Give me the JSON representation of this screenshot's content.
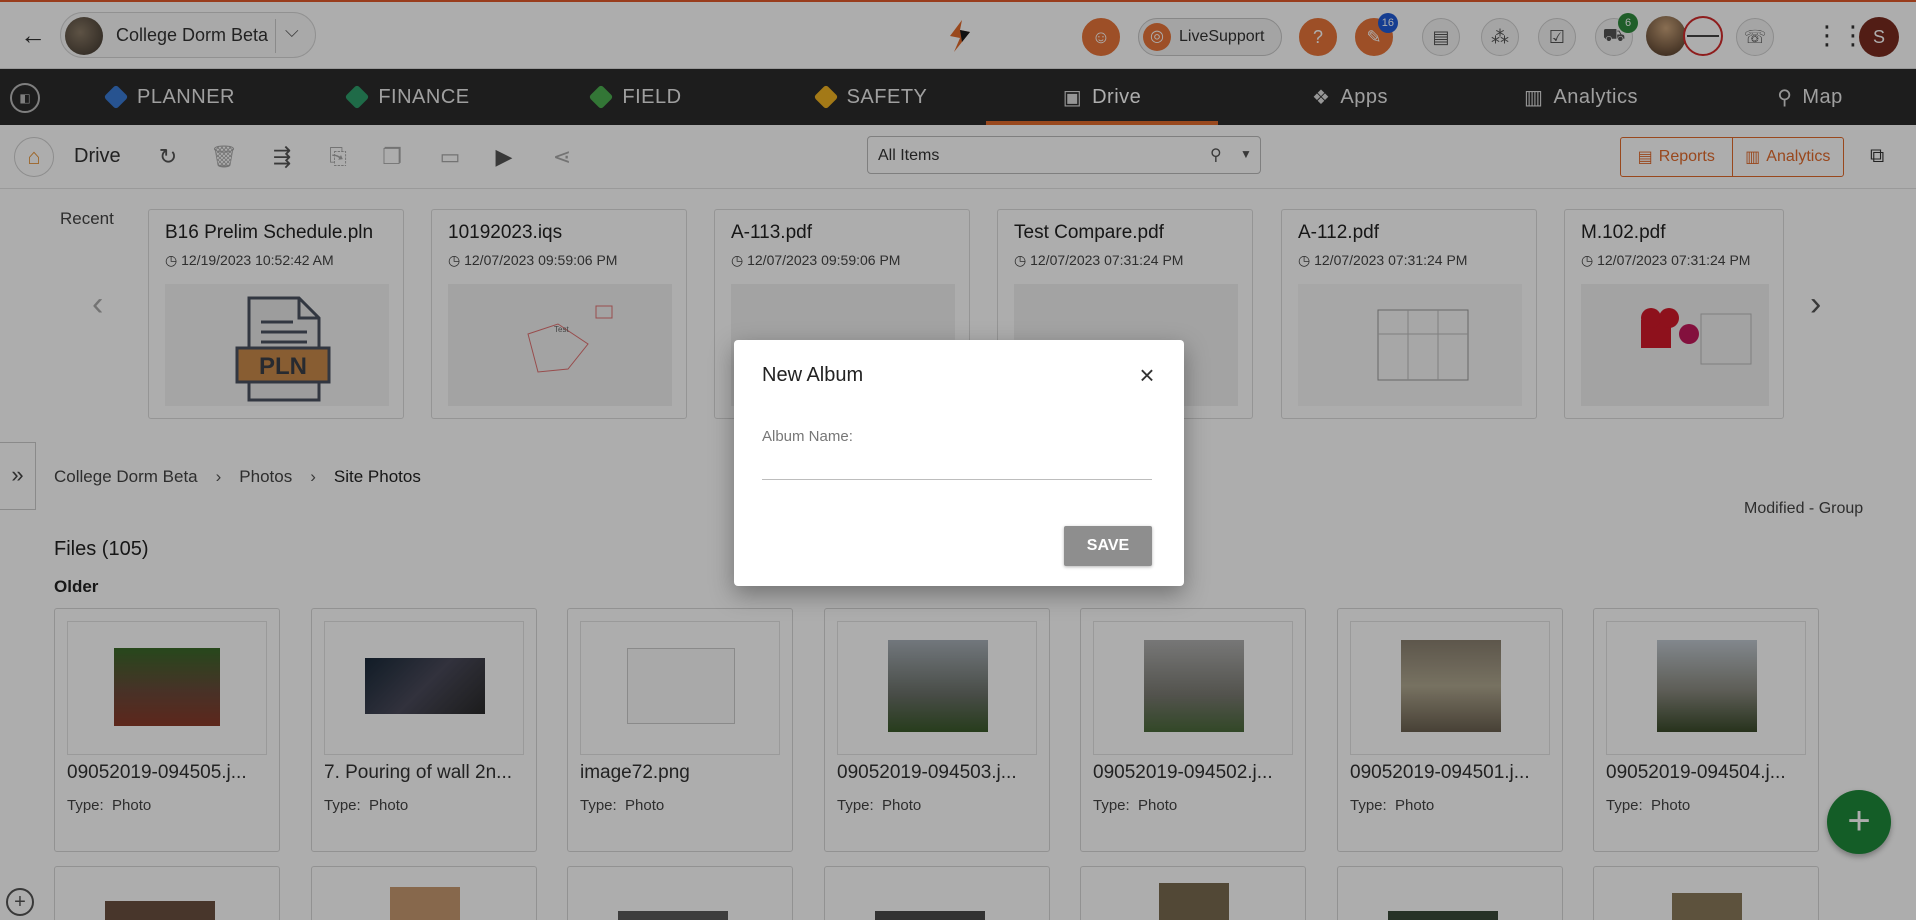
{
  "topbar": {
    "project_name": "College Dorm Beta",
    "live_support_label": "LiveSupport",
    "notification_badge": "16",
    "cart_badge": "6",
    "user_initial": "S"
  },
  "modules": [
    {
      "label": "PLANNER",
      "color": "#3a7bd5"
    },
    {
      "label": "FINANCE",
      "color": "#2e9e6a"
    },
    {
      "label": "FIELD",
      "color": "#4caf50"
    },
    {
      "label": "SAFETY",
      "color": "#f0b323"
    },
    {
      "label": "Drive",
      "icon": "drive-icon",
      "active": true
    },
    {
      "label": "Apps",
      "icon": "apps-logo-icon"
    },
    {
      "label": "Analytics",
      "icon": "bar-chart-icon"
    },
    {
      "label": "Map",
      "icon": "map-pin-icon"
    }
  ],
  "toolbar": {
    "title": "Drive",
    "filter_value": "All Items",
    "reports_label": "Reports",
    "analytics_label": "Analytics"
  },
  "recent": {
    "label": "Recent",
    "items": [
      {
        "name": "B16 Prelim Schedule.pln",
        "date": "12/19/2023 10:52:42 AM"
      },
      {
        "name": "10192023.iqs",
        "date": "12/07/2023 09:59:06 PM"
      },
      {
        "name": "A-113.pdf",
        "date": "12/07/2023 09:59:06 PM"
      },
      {
        "name": "Test Compare.pdf",
        "date": "12/07/2023 07:31:24 PM"
      },
      {
        "name": "A-112.pdf",
        "date": "12/07/2023 07:31:24 PM"
      },
      {
        "name": "M.102.pdf",
        "date": "12/07/2023 07:31:24 PM"
      }
    ],
    "pln_label": "PLN",
    "thumb_text": "Test"
  },
  "breadcrumb": [
    "College Dorm Beta",
    "Photos",
    "Site Photos"
  ],
  "group_label": "Modified - Group",
  "files_count": "Files (105)",
  "section_label": "Older",
  "type_label": "Type:",
  "files": [
    {
      "name": "09052019-094505.j...",
      "type": "Photo"
    },
    {
      "name": "7. Pouring of wall 2n...",
      "type": "Photo"
    },
    {
      "name": "image72.png",
      "type": "Photo"
    },
    {
      "name": "09052019-094503.j...",
      "type": "Photo"
    },
    {
      "name": "09052019-094502.j...",
      "type": "Photo"
    },
    {
      "name": "09052019-094501.j...",
      "type": "Photo"
    },
    {
      "name": "09052019-094504.j...",
      "type": "Photo"
    }
  ],
  "dialog": {
    "title": "New Album",
    "field_label": "Album Name:",
    "field_value": "",
    "save_label": "SAVE"
  },
  "colors": {
    "accent": "#e26a2c",
    "nav_bg": "#2c2c2c",
    "fab": "#1e8a3a",
    "save_button": "#8e8e8e"
  }
}
